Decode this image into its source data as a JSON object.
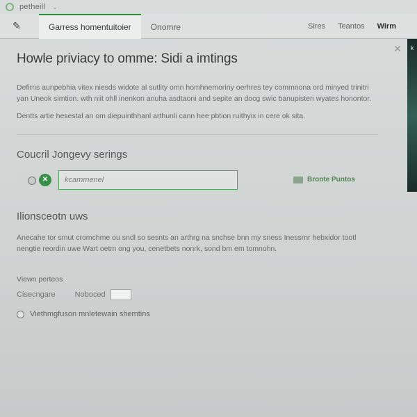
{
  "app": {
    "title": "petheill"
  },
  "toolbar": {
    "edit_icon": "pencil",
    "tabs": {
      "active": "Garress homentuitoier",
      "t2": "Onomre",
      "right": [
        "Sires",
        "Teantos",
        "Wirm"
      ]
    }
  },
  "header": {
    "title": "Howle priviacy to omme: Sidi a imtings"
  },
  "intro": {
    "p1": "Defirns aunpebhia vitex niesds widote al sutlity omn homhnemoriny oerhres tey commnona ord minyed trinitri yan Uneok simtion. wth niit ohll inenkon anuha asdtaoni and sepite an docg swic banupisten wyates honontor.",
    "p2": "Dentts artie hesestal an om diepuinthhanl arthunli cann hee pbtion ruithyix in cere ok sita."
  },
  "current": {
    "heading": "Coucril Jongevy serings",
    "status_icon": "ok",
    "input_placeholder": "kcammenel",
    "browse_label": "Bronte Puntos"
  },
  "section2": {
    "heading": "Ilionsceotn uws",
    "p1": "Anecahe tor smut cromchme ou sndl so sesnts an arthrg na snchse bnn my sness Inessrnr hebxidor tootl nengtie reordin uwe Wart oetm ong you, cenetbets nonrk, sond bm em tomnohn."
  },
  "parts": {
    "label": "Viewn perteos",
    "opt1": "Cisecngare",
    "opt2": "Noboced",
    "radio_label": "Viethmgfuson mnletewain shemtins"
  }
}
